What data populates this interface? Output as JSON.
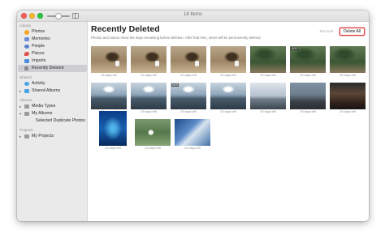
{
  "window": {
    "title": "18 Items"
  },
  "sidebar": {
    "sections": [
      {
        "title": "Library"
      },
      {
        "title": "Shared"
      },
      {
        "title": "Albums"
      },
      {
        "title": "Projects"
      }
    ],
    "items": [
      {
        "label": "Photos",
        "icon": "photos-icon"
      },
      {
        "label": "Memories",
        "icon": "memories-icon"
      },
      {
        "label": "People",
        "icon": "people-icon"
      },
      {
        "label": "Places",
        "icon": "places-icon"
      },
      {
        "label": "Imports",
        "icon": "imports-icon"
      },
      {
        "label": "Recently Deleted",
        "icon": "trash-icon",
        "selected": true
      },
      {
        "label": "Activity",
        "icon": "activity-icon"
      },
      {
        "label": "Shared Albums",
        "icon": "shared-albums-icon"
      },
      {
        "label": "Media Types",
        "icon": "folder-icon"
      },
      {
        "label": "My Albums",
        "icon": "folder-icon"
      },
      {
        "label": "Selected Duplicate Photos",
        "icon": "album-icon"
      },
      {
        "label": "My Projects",
        "icon": "folder-icon"
      }
    ]
  },
  "main": {
    "title": "Recently Deleted",
    "subtitle": "Photos and videos show the days remaining before deletion. After that time, items will be permanently deleted.",
    "recover_label": "Recover",
    "delete_all_label": "Delete All",
    "hdr_label": "HDR",
    "thumbnails": [
      {
        "caption": "29 days left",
        "kind": "tree",
        "hdr": false
      },
      {
        "caption": "29 days left",
        "kind": "tree",
        "hdr": false
      },
      {
        "caption": "29 days left",
        "kind": "tree",
        "hdr": false
      },
      {
        "caption": "29 days left",
        "kind": "tree",
        "hdr": false
      },
      {
        "caption": "29 days left",
        "kind": "grass",
        "hdr": false
      },
      {
        "caption": "29 days left",
        "kind": "grass",
        "hdr": true
      },
      {
        "caption": "29 days left",
        "kind": "grass",
        "hdr": false
      },
      {
        "caption": "29 days left",
        "kind": "sky",
        "hdr": false
      },
      {
        "caption": "29 days left",
        "kind": "sky",
        "hdr": false
      },
      {
        "caption": "29 days left",
        "kind": "sky",
        "hdr": true
      },
      {
        "caption": "29 days left",
        "kind": "sky",
        "hdr": false
      },
      {
        "caption": "29 days left",
        "kind": "beach",
        "hdr": false
      },
      {
        "caption": "29 days left",
        "kind": "boat",
        "hdr": false
      },
      {
        "caption": "29 days left",
        "kind": "dark",
        "hdr": false
      },
      {
        "caption": "29 days left",
        "kind": "aquarium",
        "hdr": false
      },
      {
        "caption": "29 days left",
        "kind": "green",
        "hdr": false
      },
      {
        "caption": "29 days left",
        "kind": "blue",
        "hdr": false
      }
    ]
  },
  "colors": {
    "selection": "#cfcfd3",
    "delete_border": "#e53b3b",
    "sidebar_bg": "#eaeaea"
  }
}
